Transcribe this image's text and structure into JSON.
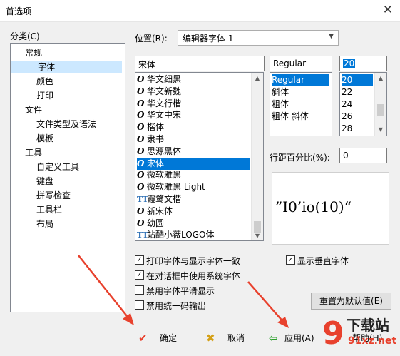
{
  "window": {
    "title": "首选项",
    "close_glyph": "✕"
  },
  "category": {
    "label": "分类(C)",
    "items": [
      {
        "label": "常规",
        "level": 0
      },
      {
        "label": "字体",
        "level": 1,
        "selected": true
      },
      {
        "label": "颜色",
        "level": 1
      },
      {
        "label": "打印",
        "level": 1
      },
      {
        "label": "文件",
        "level": 0
      },
      {
        "label": "文件类型及语法",
        "level": 1
      },
      {
        "label": "模板",
        "level": 1
      },
      {
        "label": "工具",
        "level": 0
      },
      {
        "label": "自定义工具",
        "level": 1
      },
      {
        "label": "键盘",
        "level": 1
      },
      {
        "label": "拼写检查",
        "level": 1
      },
      {
        "label": "工具栏",
        "level": 1
      },
      {
        "label": "布局",
        "level": 1
      }
    ]
  },
  "position": {
    "label": "位置(R):",
    "value": "编辑器字体 1"
  },
  "font": {
    "value": "宋体",
    "items": [
      {
        "icon": "O",
        "name": "华文细黑"
      },
      {
        "icon": "O",
        "name": "华文新魏"
      },
      {
        "icon": "O",
        "name": "华文行楷"
      },
      {
        "icon": "O",
        "name": "华文中宋"
      },
      {
        "icon": "O",
        "name": "楷体"
      },
      {
        "icon": "O",
        "name": "隶书"
      },
      {
        "icon": "O",
        "name": "思源黑体"
      },
      {
        "icon": "O",
        "name": "宋体",
        "selected": true
      },
      {
        "icon": "O",
        "name": "微软雅黑"
      },
      {
        "icon": "O",
        "name": "微软雅黑 Light"
      },
      {
        "icon": "TT",
        "name": "霞鹜文楷"
      },
      {
        "icon": "O",
        "name": "新宋体"
      },
      {
        "icon": "O",
        "name": "幼圆"
      },
      {
        "icon": "TT",
        "name": "站酷小薇LOGO体"
      }
    ]
  },
  "style": {
    "value": "Regular",
    "items": [
      {
        "name": "Regular",
        "selected": true
      },
      {
        "name": "斜体"
      },
      {
        "name": "粗体"
      },
      {
        "name": "粗体 斜体"
      }
    ]
  },
  "size": {
    "value": "20",
    "items": [
      {
        "name": "20",
        "selected": true
      },
      {
        "name": "22"
      },
      {
        "name": "24"
      },
      {
        "name": "26"
      },
      {
        "name": "28"
      }
    ]
  },
  "line_spacing": {
    "label": "行距百分比(%):",
    "value": "0"
  },
  "preview": {
    "text": "”I0’io(10)“"
  },
  "options": {
    "print_font_same": {
      "label": "打印字体与显示字体一致",
      "checked": true
    },
    "use_system_font": {
      "label": "在对话框中使用系统字体",
      "checked": true
    },
    "disable_smoothing": {
      "label": "禁用字体平滑显示",
      "checked": false
    },
    "disable_unicode": {
      "label": "禁用统一码输出",
      "checked": false
    },
    "show_vertical_font": {
      "label": "显示垂直字体",
      "checked": true
    }
  },
  "buttons": {
    "reset": "重置为默认值(E)",
    "ok": "确定",
    "cancel": "取消",
    "apply": "应用(A)",
    "help": "帮助(H)"
  },
  "watermark": {
    "text": "下载站",
    "url": "91xz.net"
  },
  "colors": {
    "accent": "#0078d7",
    "arrow": "#e8412d",
    "selected_tree": "#cce8ff"
  }
}
